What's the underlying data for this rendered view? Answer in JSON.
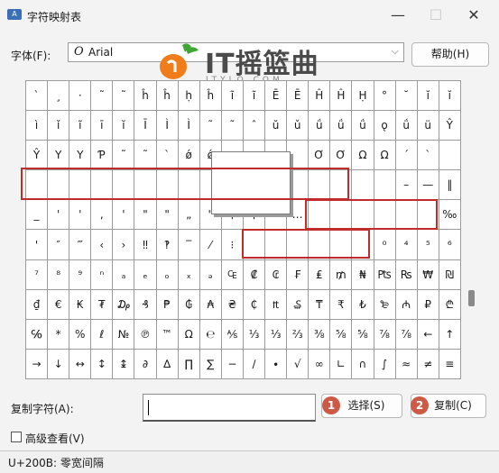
{
  "window": {
    "title": "字符映射表",
    "app_icon_glyph": "A",
    "minimize_glyph": "—",
    "maximize_glyph": "☐",
    "close_glyph": "✕"
  },
  "font_row": {
    "label": "字体(F):",
    "font_icon_glyph": "O",
    "selected_font": "Arial",
    "dropdown_arrow": "⌵",
    "help_button": "帮助(H)"
  },
  "watermark": {
    "logo_text": "IT摇篮曲",
    "url_text": "ITYLQ.COM",
    "colors": {
      "orange": "#f07d1a",
      "green": "#3fa535"
    }
  },
  "grid": {
    "columns": 20,
    "rows": 10,
    "cells": [
      [
        "`",
        "¸",
        "·",
        "˜",
        "˜",
        "ĥ",
        "ĥ",
        "ḥ",
        "ĥ",
        "ĩ",
        "ĩ",
        "Ē",
        "Ē",
        "Ĥ",
        "Ĥ",
        "Ḥ",
        "°",
        "˘",
        "ĭ",
        "ĭ"
      ],
      [
        "ì",
        "ǐ",
        "ĩ",
        "ī",
        "ĭ",
        "Ī",
        "Ì",
        "Ì",
        "˜",
        "˜",
        "ˆ",
        "ŭ",
        "ǔ",
        "ǘ",
        "ǘ",
        "ǘ",
        "ǫ",
        "ǘ",
        "ü",
        "Ŷ"
      ],
      [
        "Ŷ",
        "Υ",
        "Υ",
        "Ƥ",
        "˜",
        "˜",
        "`",
        "ǿ",
        "ǿ",
        "",
        "",
        "",
        "",
        "Ơ",
        "Ơ",
        "Ω",
        "Ω",
        "´",
        "`",
        ""
      ],
      [
        "",
        "",
        "",
        "",
        "",
        "",
        "",
        "",
        "",
        "",
        "",
        "",
        "",
        "",
        "",
        "",
        "",
        "–",
        "—",
        "‖"
      ],
      [
        "_",
        "'",
        "'",
        ",",
        "'",
        "\"",
        "\"",
        "„",
        "\"",
        "†",
        "‡",
        "•",
        "…",
        "",
        "",
        "",
        "",
        "",
        "",
        "‰"
      ],
      [
        "'",
        "″",
        "‴",
        "‹",
        "›",
        "‼",
        "‽",
        "‾",
        "⁄",
        "⁝",
        "",
        "",
        "",
        "",
        "",
        "",
        "⁰",
        "⁴",
        "⁵",
        "⁶"
      ],
      [
        "⁷",
        "⁸",
        "⁹",
        "ⁿ",
        "ₐ",
        "ₑ",
        "ₒ",
        "ₓ",
        "ₔ",
        "₠",
        "₡",
        "₢",
        "₣",
        "₤",
        "₥",
        "₦",
        "₧",
        "₨",
        "₩",
        "₪"
      ],
      [
        "₫",
        "€",
        "₭",
        "₮",
        "₯",
        "₰",
        "₱",
        "₲",
        "₳",
        "₴",
        "₵",
        "₶",
        "₷",
        "₸",
        "₹",
        "₺",
        "₻",
        "₼",
        "₽",
        "₾"
      ],
      [
        "℅",
        "*",
        "%",
        "ℓ",
        "№",
        "℗",
        "™",
        "Ω",
        "℮",
        "⅍",
        "⅓",
        "⅓",
        "⅔",
        "⅜",
        "⅝",
        "⅝",
        "⅞",
        "⅞",
        "←",
        "↑"
      ],
      [
        "→",
        "↓",
        "↔",
        "↕",
        "↨",
        "∂",
        "∆",
        "∏",
        "∑",
        "−",
        "∕",
        "∙",
        "√",
        "∞",
        "∟",
        "∩",
        "∫",
        "≈",
        "≠",
        "≡"
      ]
    ]
  },
  "copy_row": {
    "label": "复制字符(A):",
    "input_value": "",
    "select_button": "选择(S)",
    "copy_button": "复制(C)",
    "badge_1": "1",
    "badge_2": "2",
    "badge_color": "#cd5a45"
  },
  "advanced": {
    "label": "高级查看(V)",
    "checked": false
  },
  "status_bar": {
    "text": "U+200B: 零宽间隔"
  },
  "highlight_color": "#c02b2b"
}
